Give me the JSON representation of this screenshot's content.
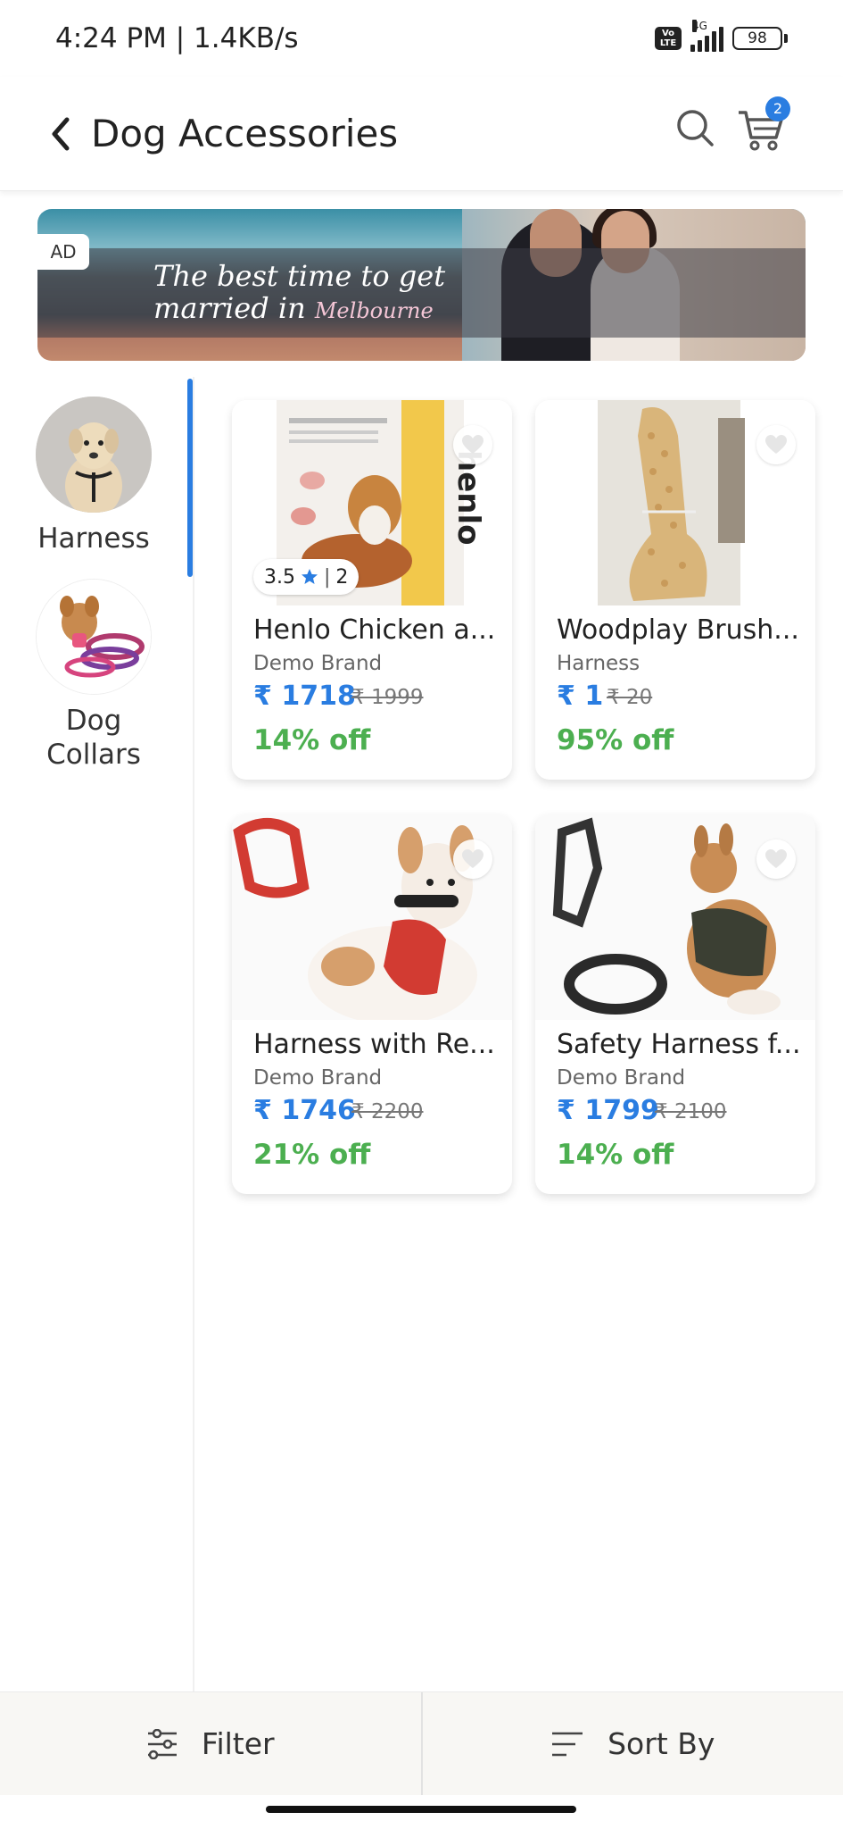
{
  "status": {
    "time": "4:24 PM | 1.4KB/s",
    "volte": "Vo LTE",
    "network": "4G",
    "battery": "98"
  },
  "header": {
    "title": "Dog Accessories",
    "cart_count": "2"
  },
  "ad": {
    "tag": "AD",
    "line1": "The best time to get",
    "line2": "married in",
    "city": "Melbourne"
  },
  "categories": [
    {
      "label": "Harness",
      "selected": true
    },
    {
      "label": "Dog\nCollars",
      "selected": false
    }
  ],
  "products": [
    {
      "name": "Henlo Chicken a...",
      "brand": "Demo Brand",
      "price": "₹ 1718",
      "mrp": "₹ 1999",
      "off": "14% off",
      "rating": "3.5",
      "reviews": "2",
      "image_text": "henlo"
    },
    {
      "name": "Woodplay Brush...",
      "brand": "Harness",
      "price": "₹ 1",
      "mrp": "₹ 20",
      "off": "95% off"
    },
    {
      "name": "Harness with Re...",
      "brand": "Demo Brand",
      "price": "₹ 1746",
      "mrp": "₹ 2200",
      "off": "21% off"
    },
    {
      "name": "Safety Harness f...",
      "brand": "Demo Brand",
      "price": "₹ 1799",
      "mrp": "₹ 2100",
      "off": "14% off"
    }
  ],
  "bottom": {
    "filter": "Filter",
    "sort": "Sort By"
  },
  "colors": {
    "accent": "#2a7de1",
    "discount": "#4caf50"
  }
}
